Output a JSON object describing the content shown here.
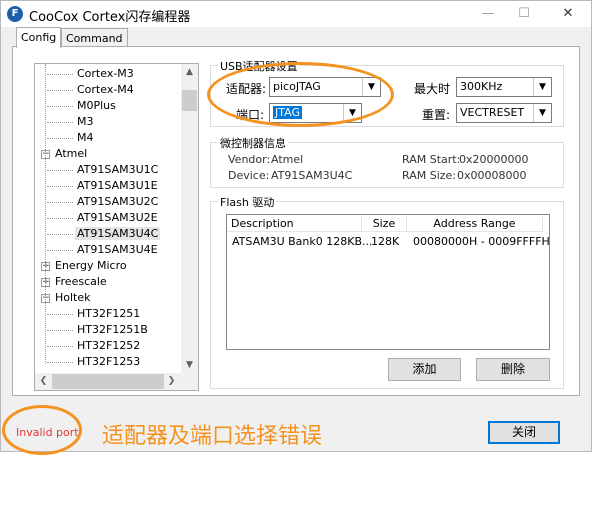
{
  "window": {
    "title": "CooCox Cortex闪存编程器",
    "app_icon": "F",
    "controls": {
      "minimize": "—",
      "maximize": "☐",
      "close": "✕"
    }
  },
  "tabs": [
    {
      "label": "Config",
      "active": true
    },
    {
      "label": "Command",
      "active": false
    }
  ],
  "tree": {
    "items": [
      {
        "label": "Cortex-M3",
        "level": 2
      },
      {
        "label": "Cortex-M4",
        "level": 2
      },
      {
        "label": "M0Plus",
        "level": 2
      },
      {
        "label": "M3",
        "level": 2
      },
      {
        "label": "M4",
        "level": 2
      },
      {
        "label": "Atmel",
        "level": 1,
        "expander": "−"
      },
      {
        "label": "AT91SAM3U1C",
        "level": 2
      },
      {
        "label": "AT91SAM3U1E",
        "level": 2
      },
      {
        "label": "AT91SAM3U2C",
        "level": 2
      },
      {
        "label": "AT91SAM3U2E",
        "level": 2
      },
      {
        "label": "AT91SAM3U4C",
        "level": 2,
        "selected": true
      },
      {
        "label": "AT91SAM3U4E",
        "level": 2
      },
      {
        "label": "Energy Micro",
        "level": 1,
        "expander": "+"
      },
      {
        "label": "Freescale",
        "level": 1,
        "expander": "+"
      },
      {
        "label": "Holtek",
        "level": 1,
        "expander": "−"
      },
      {
        "label": "HT32F1251",
        "level": 2
      },
      {
        "label": "HT32F1251B",
        "level": 2
      },
      {
        "label": "HT32F1252",
        "level": 2
      },
      {
        "label": "HT32F1253",
        "level": 2
      }
    ]
  },
  "usb_adapter": {
    "group_title": "USB适配器设置",
    "adapter_label": "适配器:",
    "adapter_value": "picoJTAG",
    "port_label": "端口:",
    "port_value": "JTAG",
    "max_clock_label": "最大时",
    "max_clock_value": "300KHz",
    "reset_label": "重置:",
    "reset_value": "VECTRESET"
  },
  "mcu_info": {
    "group_title": "微控制器信息",
    "vendor_label": "Vendor:",
    "vendor_value": "Atmel",
    "device_label": "Device:",
    "device_value": "AT91SAM3U4C",
    "ram_start_label": "RAM Start:",
    "ram_start_value": "0x20000000",
    "ram_size_label": "RAM Size:",
    "ram_size_value": "0x00008000"
  },
  "flash": {
    "group_title": "Flash 驱动",
    "columns": [
      "Description",
      "Size",
      "Address Range"
    ],
    "rows": [
      {
        "description": "ATSAM3U Bank0 128KB...",
        "size": "128K",
        "address": "00080000H - 0009FFFFH"
      }
    ],
    "add_button": "添加",
    "delete_button": "删除"
  },
  "footer": {
    "status": "Invalid port",
    "close_button": "关闭"
  },
  "annotation": {
    "text": "适配器及端口选择错误",
    "color": "#f4921f"
  },
  "colors": {
    "accent": "#0078d7",
    "error": "#e53935",
    "annotation": "#f4921f"
  }
}
